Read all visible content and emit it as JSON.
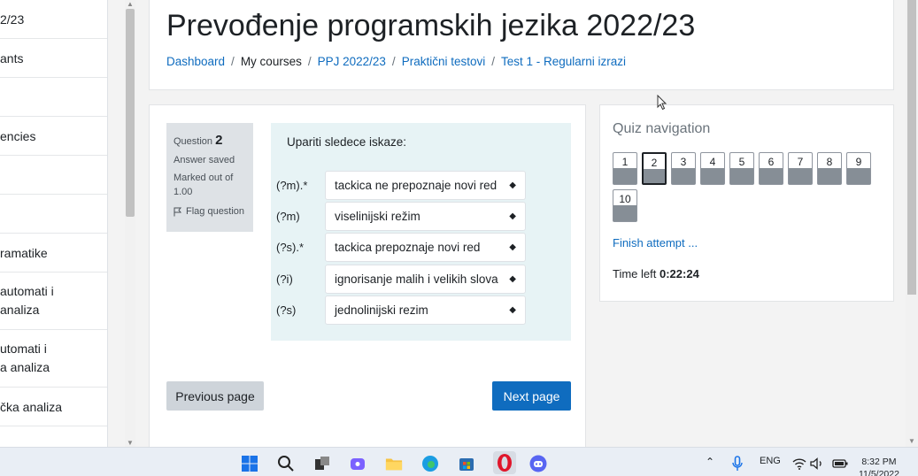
{
  "drawer": {
    "items": [
      {
        "label": "2/23"
      },
      {
        "label": "ants"
      },
      {
        "label": ""
      },
      {
        "label": "encies"
      },
      {
        "label": ""
      },
      {
        "label": ""
      },
      {
        "label": "ramatike"
      },
      {
        "label": " automati i\n analiza"
      },
      {
        "label": "utomati i\na analiza"
      },
      {
        "label": "čka analiza"
      }
    ]
  },
  "header": {
    "title": "Prevođenje programskih jezika 2022/23",
    "breadcrumb": [
      "Dashboard",
      "My courses",
      "PPJ 2022/23",
      "Praktični testovi",
      "Test 1 - Regularni izrazi"
    ]
  },
  "question": {
    "label": "Question",
    "number": "2",
    "state": "Answer saved",
    "grade": "Marked out of 1.00",
    "flag": "Flag question",
    "text": "Upariti sledece iskaze:",
    "rows": [
      {
        "stem": "(?m).*",
        "answer": "tackica ne prepoznaje novi red"
      },
      {
        "stem": "(?m)",
        "answer": "viselinijski režim"
      },
      {
        "stem": "(?s).*",
        "answer": "tackica prepoznaje novi red"
      },
      {
        "stem": "(?i)",
        "answer": "ignorisanje malih i velikih slova"
      },
      {
        "stem": "(?s)",
        "answer": "jednolinijski rezim"
      }
    ]
  },
  "buttons": {
    "previous": "Previous page",
    "next": "Next page"
  },
  "quiz_nav": {
    "title": "Quiz navigation",
    "questions": [
      "1",
      "2",
      "3",
      "4",
      "5",
      "6",
      "7",
      "8",
      "9",
      "10"
    ],
    "current": "2",
    "finish": "Finish attempt ...",
    "time_label": "Time left",
    "time_value": "0:22:24"
  },
  "taskbar": {
    "lang": "ENG",
    "time": "8:32 PM",
    "date": "11/5/2022"
  },
  "colors": {
    "link": "#0f6cbf",
    "primary_button": "#0f6cbf",
    "question_box": "#e7f3f5",
    "info_box": "#dee2e6"
  }
}
